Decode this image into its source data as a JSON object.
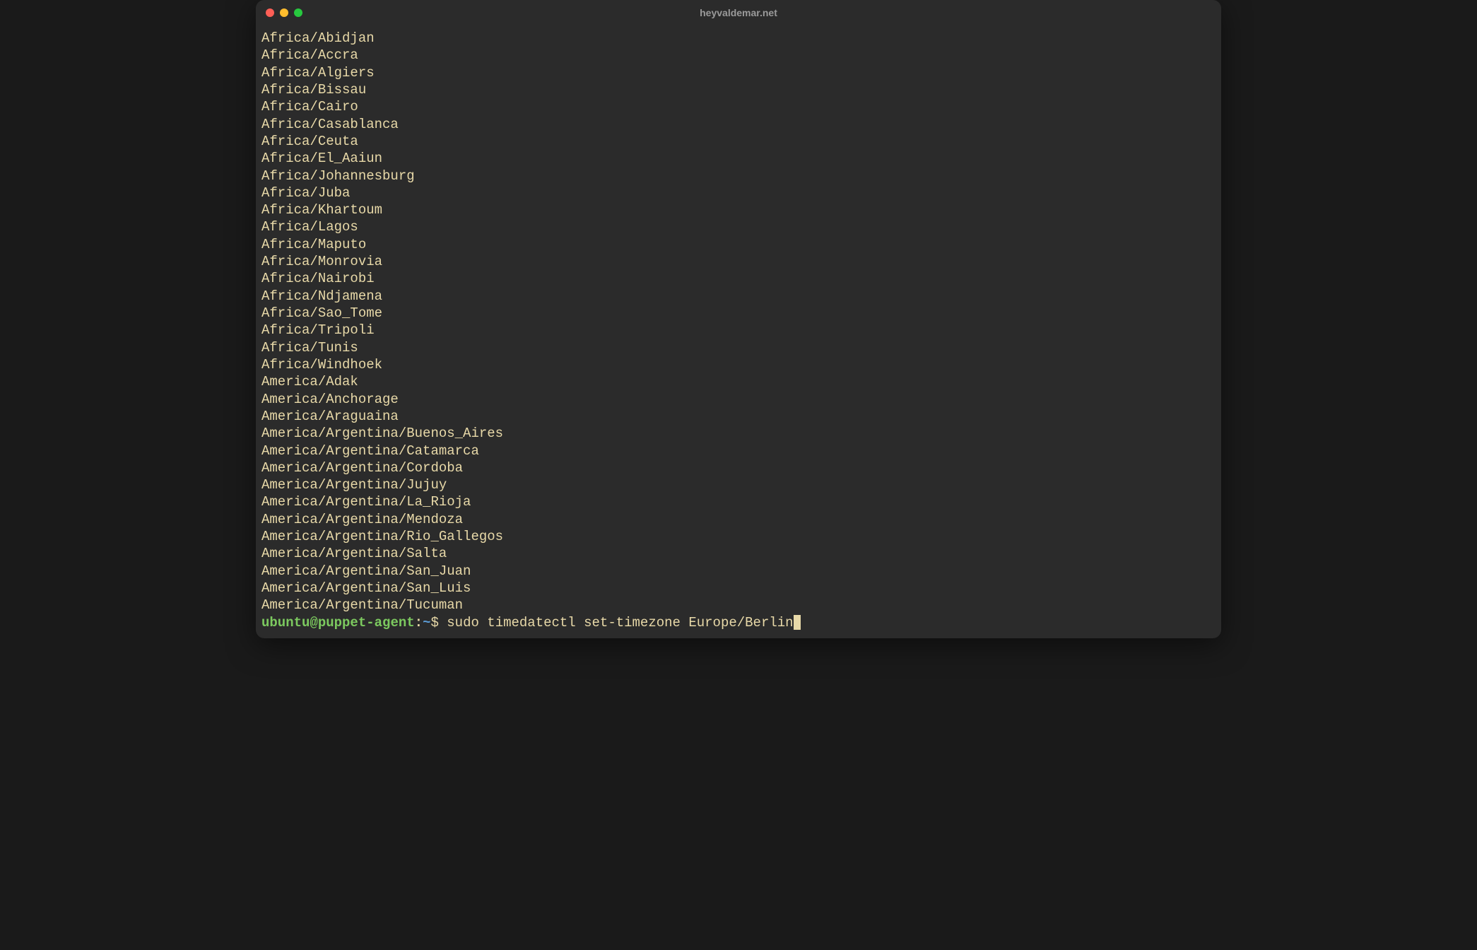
{
  "window": {
    "title": "heyvaldemar.net"
  },
  "output": {
    "lines": [
      "Africa/Abidjan",
      "Africa/Accra",
      "Africa/Algiers",
      "Africa/Bissau",
      "Africa/Cairo",
      "Africa/Casablanca",
      "Africa/Ceuta",
      "Africa/El_Aaiun",
      "Africa/Johannesburg",
      "Africa/Juba",
      "Africa/Khartoum",
      "Africa/Lagos",
      "Africa/Maputo",
      "Africa/Monrovia",
      "Africa/Nairobi",
      "Africa/Ndjamena",
      "Africa/Sao_Tome",
      "Africa/Tripoli",
      "Africa/Tunis",
      "Africa/Windhoek",
      "America/Adak",
      "America/Anchorage",
      "America/Araguaina",
      "America/Argentina/Buenos_Aires",
      "America/Argentina/Catamarca",
      "America/Argentina/Cordoba",
      "America/Argentina/Jujuy",
      "America/Argentina/La_Rioja",
      "America/Argentina/Mendoza",
      "America/Argentina/Rio_Gallegos",
      "America/Argentina/Salta",
      "America/Argentina/San_Juan",
      "America/Argentina/San_Luis",
      "America/Argentina/Tucuman"
    ]
  },
  "prompt": {
    "user": "ubuntu",
    "at": "@",
    "host": "puppet-agent",
    "colon": ":",
    "path": "~",
    "symbol": "$ ",
    "command": "sudo timedatectl set-timezone Europe/Berlin"
  }
}
